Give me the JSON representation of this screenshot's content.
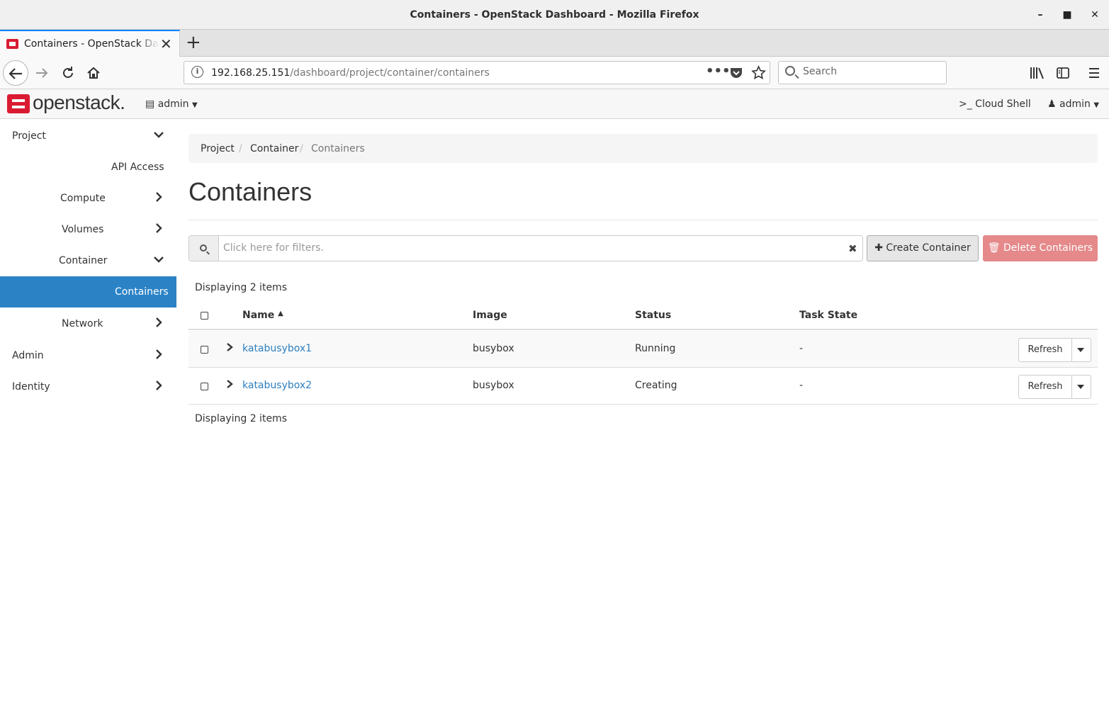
{
  "window": {
    "title": "Containers - OpenStack Dashboard - Mozilla Firefox"
  },
  "browser": {
    "tab_title": "Containers - OpenStack Dashboard",
    "url_host": "192.168.25.151",
    "url_path": "/dashboard/project/container/containers",
    "search_placeholder": "Search"
  },
  "header": {
    "logo": "openstack.",
    "project_menu": "admin",
    "cloud_shell": ">_ Cloud Shell",
    "user_menu": "admin"
  },
  "sidebar": {
    "items": [
      {
        "label": "Project"
      },
      {
        "label": "API Access"
      },
      {
        "label": "Compute"
      },
      {
        "label": "Volumes"
      },
      {
        "label": "Container"
      },
      {
        "label": "Containers"
      },
      {
        "label": "Network"
      },
      {
        "label": "Admin"
      },
      {
        "label": "Identity"
      }
    ]
  },
  "breadcrumb": {
    "items": [
      "Project",
      "Container",
      "Containers"
    ],
    "separator": "/"
  },
  "page": {
    "title": "Containers",
    "filter_placeholder": "Click here for filters.",
    "create_button": "Create Container",
    "delete_button": "Delete Containers",
    "count_top": "Displaying 2 items",
    "count_bottom": "Displaying 2 items"
  },
  "table": {
    "columns": [
      "Name",
      "Image",
      "Status",
      "Task State"
    ],
    "rows": [
      {
        "name": "katabusybox1",
        "image": "busybox",
        "status": "Running",
        "task_state": "-",
        "action": "Refresh"
      },
      {
        "name": "katabusybox2",
        "image": "busybox",
        "status": "Creating",
        "task_state": "-",
        "action": "Refresh"
      }
    ]
  },
  "colors": {
    "accent": "#2b83c6",
    "brand": "#da1a32",
    "link": "#2e7fc0",
    "danger_disabled": "#e5898a"
  }
}
